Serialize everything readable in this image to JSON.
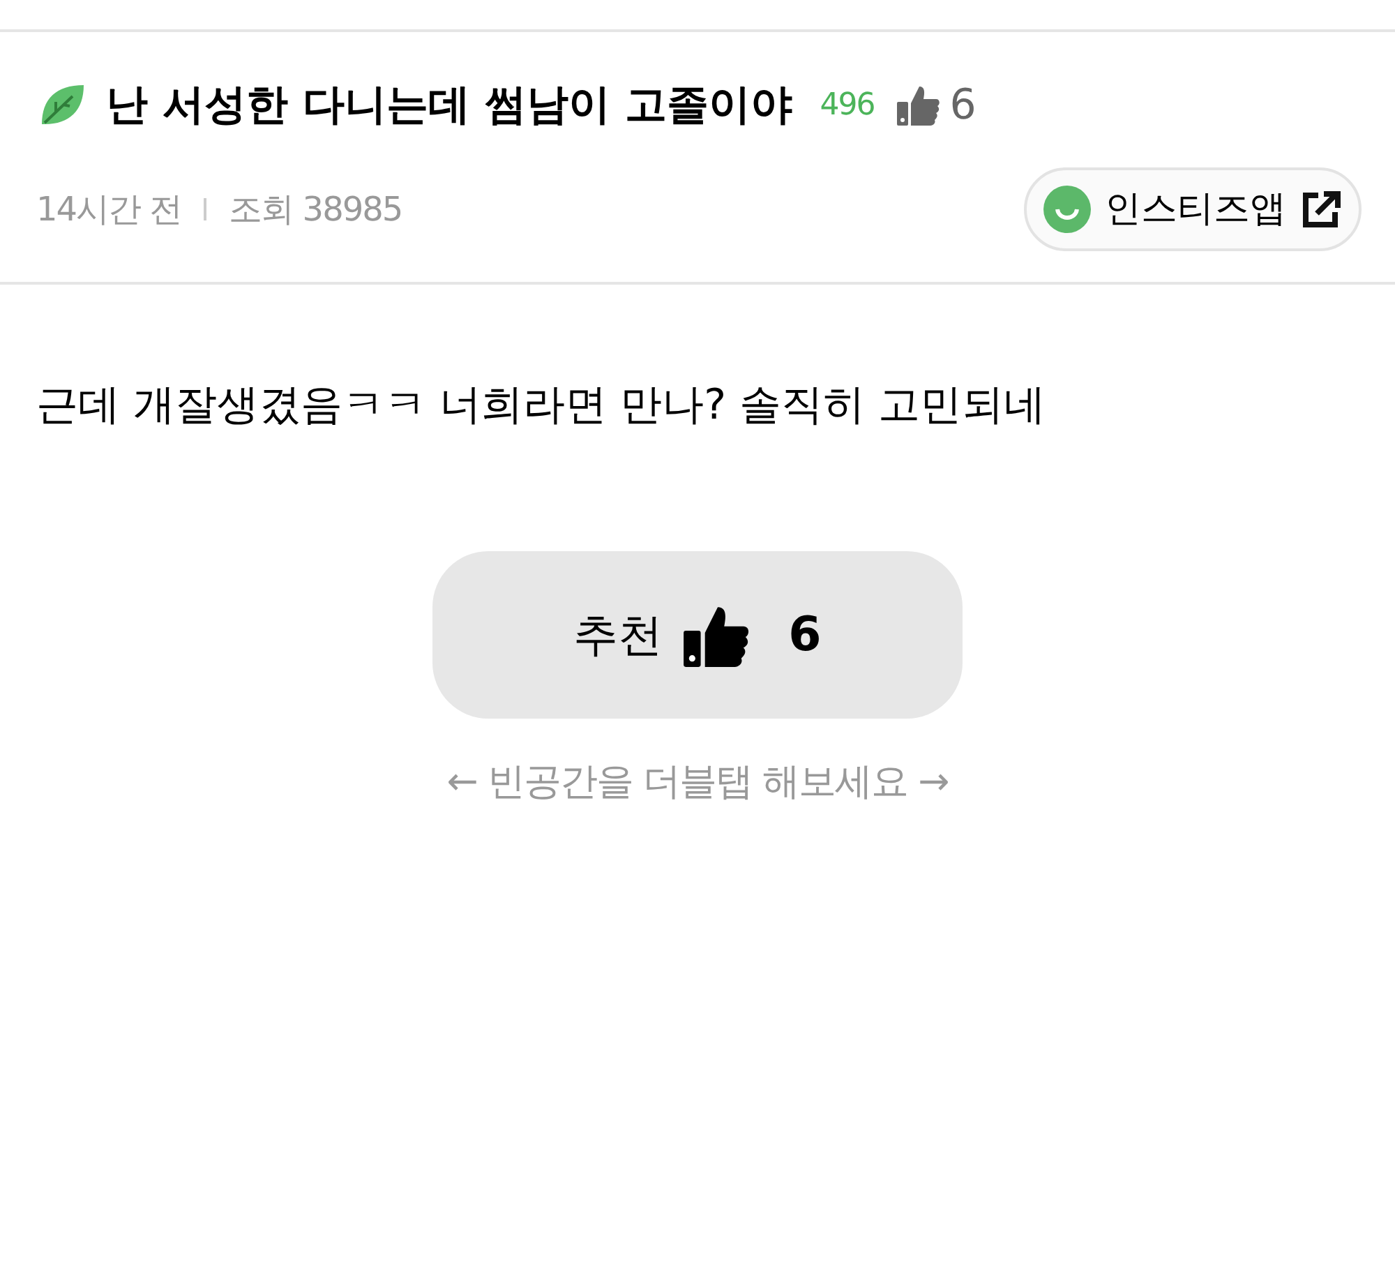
{
  "post": {
    "title": "난 서성한 다니는데 썸남이 고졸이야",
    "comment_count": "496",
    "like_count": "6",
    "time": "14시간 전",
    "views": "조회 38985"
  },
  "app_button": {
    "label": "인스티즈앱"
  },
  "body": "근데 개잘생겼음ㅋㅋ 너희라면 만나? 솔직히 고민되네",
  "recommend_button": {
    "label": "추천",
    "count": "6"
  },
  "hint": "← 빈공간을 더블탭 해보세요 →"
}
